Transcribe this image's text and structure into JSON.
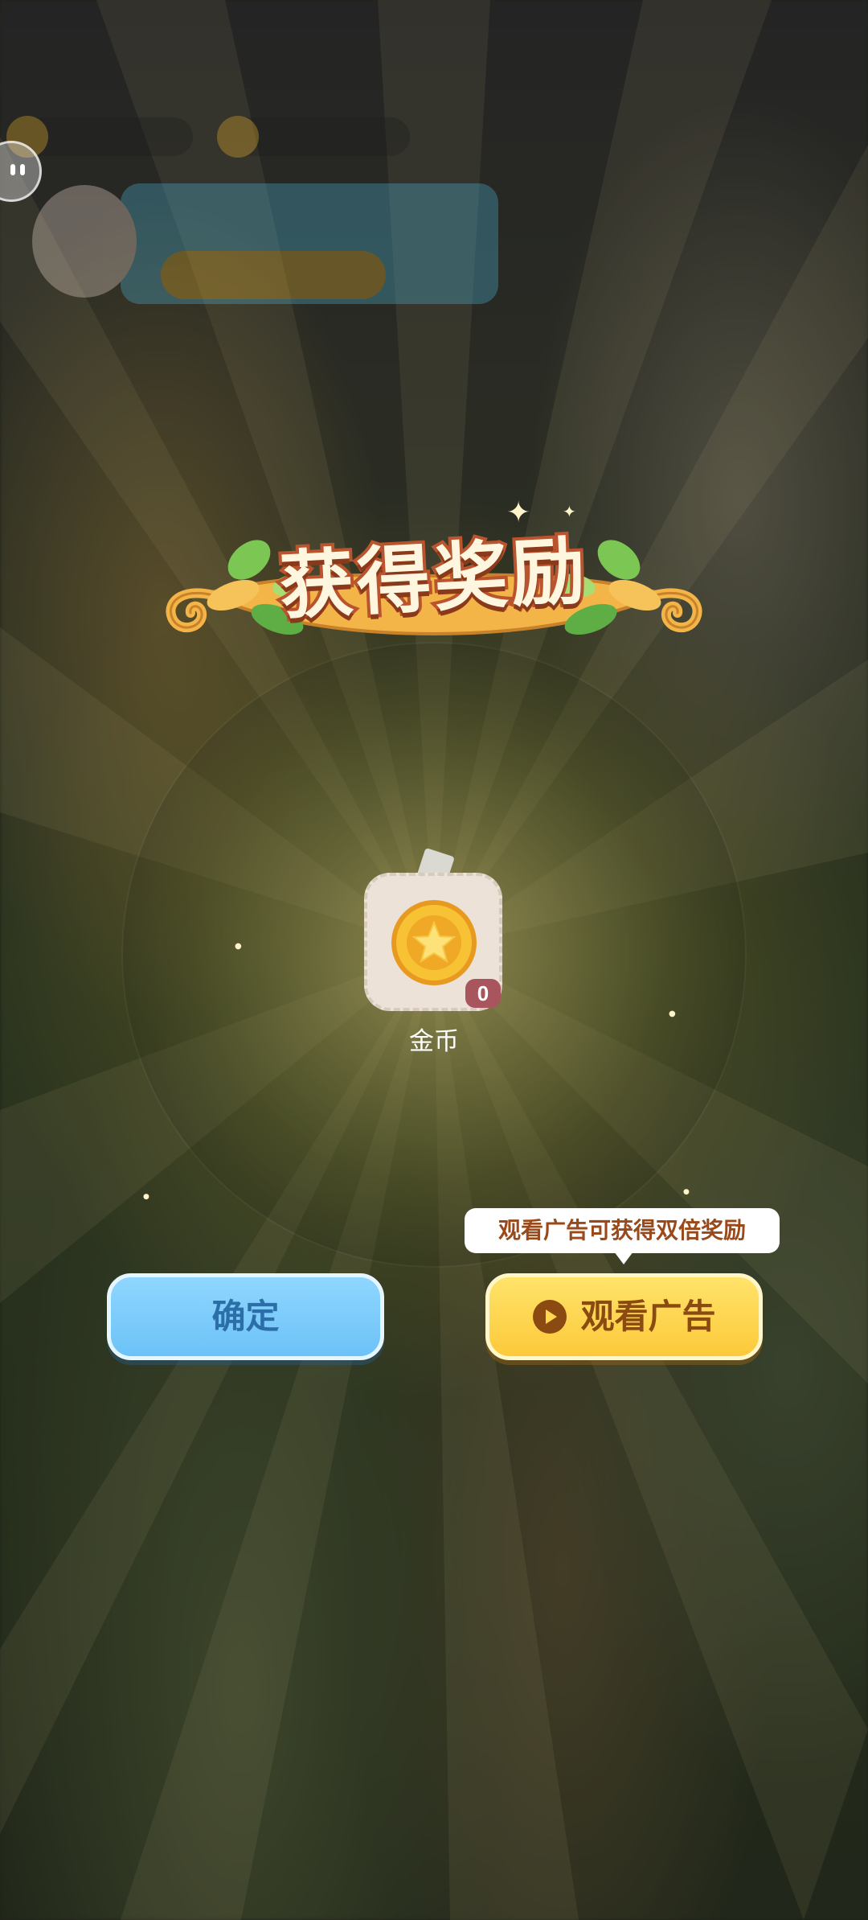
{
  "popup": {
    "title": "获得奖励",
    "reward": {
      "name": "金币",
      "count": "0",
      "icon": "gold-star-coin-icon"
    },
    "confirm_label": "确定",
    "watch_ad_label": "观看广告",
    "ad_tooltip": "观看广告可获得双倍奖励"
  },
  "colors": {
    "confirm_button": "#7ccdfb",
    "ad_button": "#fdd44c",
    "banner_gold": "#f3b547",
    "leaf_green": "#6fbf4a",
    "coin_gold": "#f5b82a"
  }
}
